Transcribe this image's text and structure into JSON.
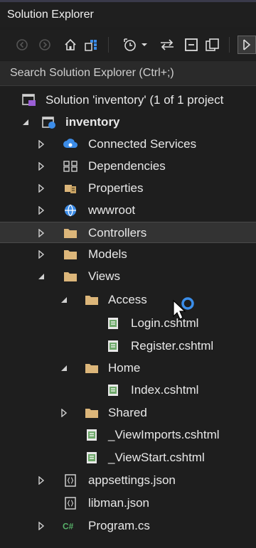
{
  "window": {
    "title": "Solution Explorer"
  },
  "search": {
    "placeholder": "Search Solution Explorer (Ctrl+;)"
  },
  "toolbar": {
    "buttons": [
      "back-icon",
      "forward-icon",
      "home-icon",
      "switch-views-icon",
      "pending-changes-icon",
      "dropdown-icon",
      "sync-icon",
      "collapse-all-icon",
      "show-all-files-icon",
      "preview-icon"
    ]
  },
  "tree": {
    "solution": {
      "label": "Solution 'inventory' (1 of 1 project"
    },
    "project": {
      "label": "inventory"
    },
    "items": {
      "connected_services": "Connected Services",
      "dependencies": "Dependencies",
      "properties": "Properties",
      "wwwroot": "wwwroot",
      "controllers": "Controllers",
      "models": "Models",
      "views": "Views",
      "access": "Access",
      "login": "Login.cshtml",
      "register": "Register.cshtml",
      "home": "Home",
      "index": "Index.cshtml",
      "shared": "Shared",
      "viewimports": "_ViewImports.cshtml",
      "viewstart": "_ViewStart.cshtml",
      "appsettings": "appsettings.json",
      "libman": "libman.json",
      "program": "Program.cs"
    },
    "selected_item": "Controllers"
  },
  "colors": {
    "background": "#1e1e1e",
    "selection": "#333333",
    "folder": "#dcb67a",
    "web_globe": "#3c8ce7",
    "csharp": "#58b36a",
    "cshtml_icon": "#6ea86a",
    "busy_ring": "#3b8eea"
  }
}
